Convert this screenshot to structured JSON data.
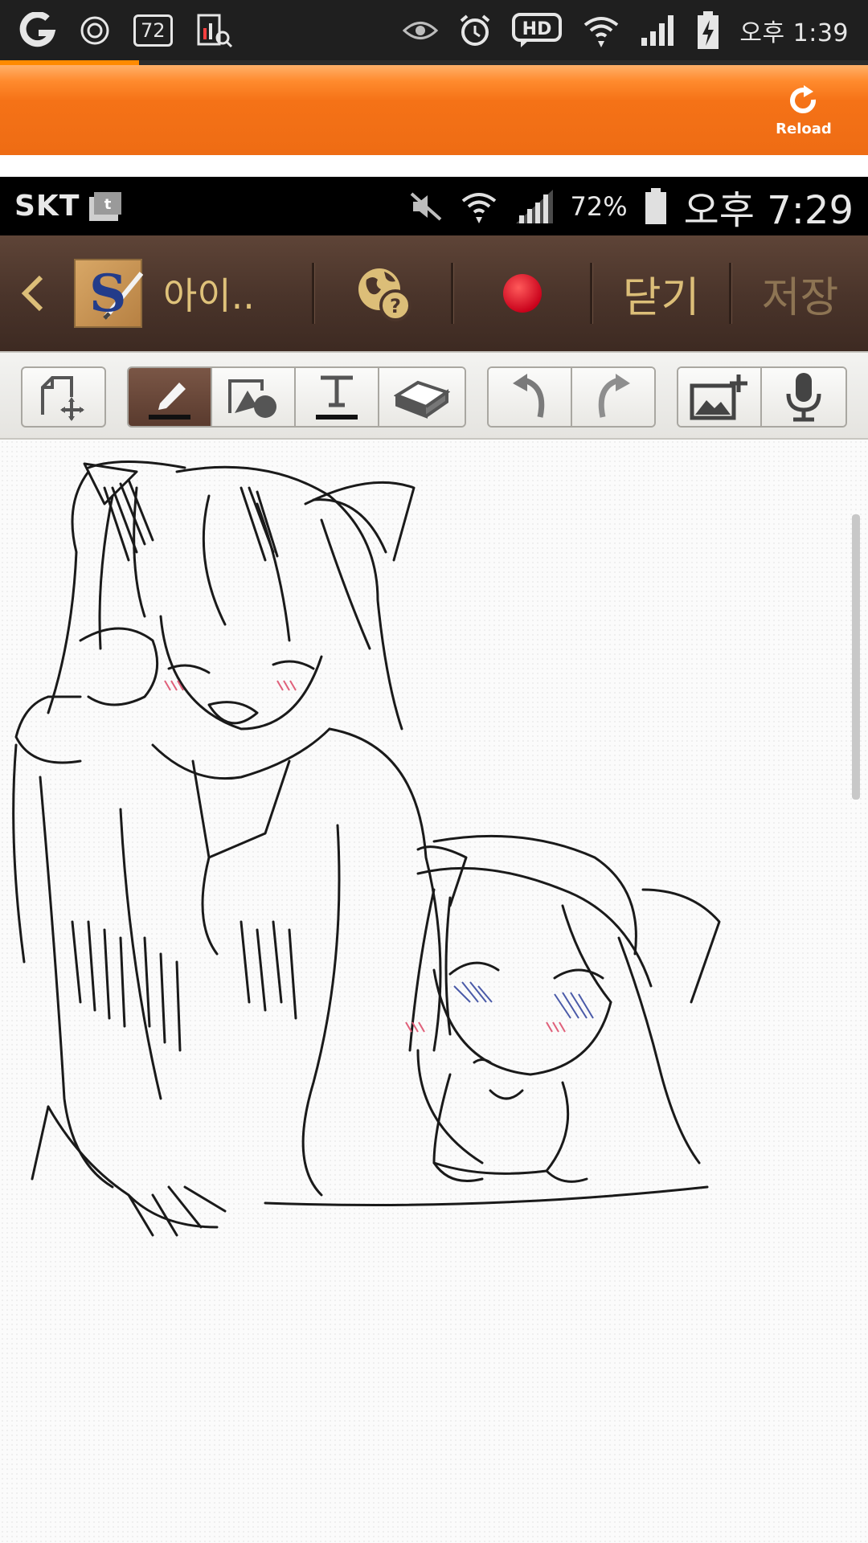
{
  "outer_status_bar": {
    "battery_text": "72",
    "time": "오후 1:39",
    "icons": [
      "g-logo-icon",
      "target-icon",
      "battery-box-icon",
      "search-chart-icon",
      "eye-icon",
      "alarm-icon",
      "hd-icon",
      "wifi-icon",
      "signal-icon",
      "battery-charging-icon"
    ]
  },
  "orange_bar": {
    "reload_label": "Reload",
    "progress": 0.16
  },
  "inner_status_bar": {
    "carrier": "SKT",
    "battery_percent": "72%",
    "time": "오후 7:29",
    "icons": [
      "t-icon",
      "mute-icon",
      "wifi-icon",
      "signal-icon",
      "battery-icon"
    ]
  },
  "app_header": {
    "title": "아이..",
    "close_label": "닫기",
    "save_label": "저장",
    "icons": [
      "back-chevron-icon",
      "s-note-logo-icon",
      "globe-help-icon",
      "record-dot-icon"
    ]
  },
  "toolbar": {
    "tools": [
      {
        "name": "page-move",
        "icon": "page-move-icon"
      },
      {
        "name": "pen",
        "icon": "pen-icon",
        "active": true
      },
      {
        "name": "shape",
        "icon": "shape-icon"
      },
      {
        "name": "text",
        "icon": "text-icon"
      },
      {
        "name": "eraser",
        "icon": "eraser-icon"
      },
      {
        "name": "undo",
        "icon": "undo-icon"
      },
      {
        "name": "redo",
        "icon": "redo-icon"
      },
      {
        "name": "add-image",
        "icon": "add-image-icon"
      },
      {
        "name": "voice",
        "icon": "mic-icon"
      }
    ]
  },
  "colors": {
    "orange": "#ee6c14",
    "header_brown": "#4b352b",
    "header_text": "#dfc27a",
    "record": "#d8001a"
  }
}
